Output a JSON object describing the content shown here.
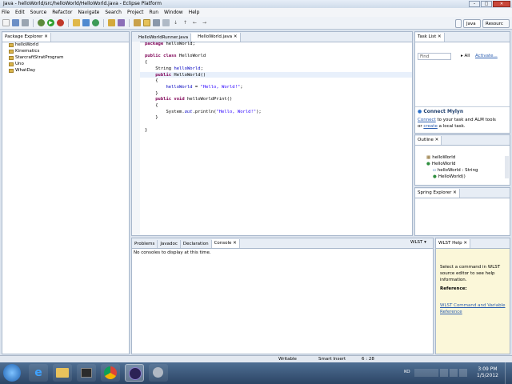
{
  "window": {
    "title": "Java - helloWorld/src/helloWorld/HelloWorld.java - Eclipse Platform"
  },
  "menu": [
    "File",
    "Edit",
    "Source",
    "Refactor",
    "Navigate",
    "Search",
    "Project",
    "Run",
    "Window",
    "Help"
  ],
  "perspectives": {
    "java": "Java",
    "resource": "Resourc"
  },
  "package_explorer": {
    "title": "Package Explorer",
    "items": [
      "helloWorld",
      "Kinematics",
      "StarcraftStratProgram",
      "Uno",
      "WhatDay"
    ]
  },
  "editor": {
    "tabs": [
      "HelloWorldRunner.java",
      "HelloWorld.java"
    ],
    "lines": {
      "l1_kw": "package",
      "l1_rest": " helloWorld;",
      "l3_kw": "public class",
      "l3_rest": " HelloWorld",
      "l4": "{",
      "l5_type": "String ",
      "l5_field": "helloWorld",
      "l5_end": ";",
      "l6_kw": "public",
      "l6_rest": " HelloWorld()",
      "l7": "{",
      "l8_field": "helloWorld",
      "l8_mid": " = ",
      "l8_str": "\"Hello, World!\"",
      "l8_end": ";",
      "l9": "}",
      "l10_kw": "public void",
      "l10_rest": " helloWorldPrint()",
      "l11": "{",
      "l12_pre": "System.",
      "l12_out": "out",
      "l12_mid": ".println(",
      "l12_str": "\"Hello, World!\"",
      "l12_end": ");",
      "l13": "}",
      "l15": "}"
    }
  },
  "task_list": {
    "title": "Task List",
    "find_placeholder": "Find",
    "all": "All",
    "activate": "Activate..."
  },
  "mylyn": {
    "title": "Connect Mylyn",
    "link1": "Connect",
    "text1": " to your task and ALM tools",
    "text2a": "or ",
    "link2": "create",
    "text2b": " a local task."
  },
  "outline": {
    "title": "Outline",
    "items": [
      "helloWorld",
      "HelloWorld",
      "helloWorld : String",
      "HelloWorld()"
    ]
  },
  "spring": {
    "title": "Spring Explorer"
  },
  "bottom_tabs": [
    "Problems",
    "Javadoc",
    "Declaration",
    "Console"
  ],
  "console": {
    "message": "No consoles to display at this time.",
    "wlst_label": "WLST"
  },
  "wlst_help": {
    "title": "WLST Help",
    "text": "Select a command in WLST source editor to see help information.",
    "reference_label": "Reference:",
    "link": "WLST Command and Variable Reference"
  },
  "statusbar": {
    "writable": "Writable",
    "insert_mode": "Smart Insert",
    "position": "6 : 28"
  },
  "taskbar": {
    "time": "3:09 PM",
    "date": "1/5/2012",
    "lang": "KO"
  },
  "colors": {
    "accent": "#2a5db0",
    "keyword": "#7f0055",
    "string": "#2a00ff",
    "field": "#0000c0"
  }
}
